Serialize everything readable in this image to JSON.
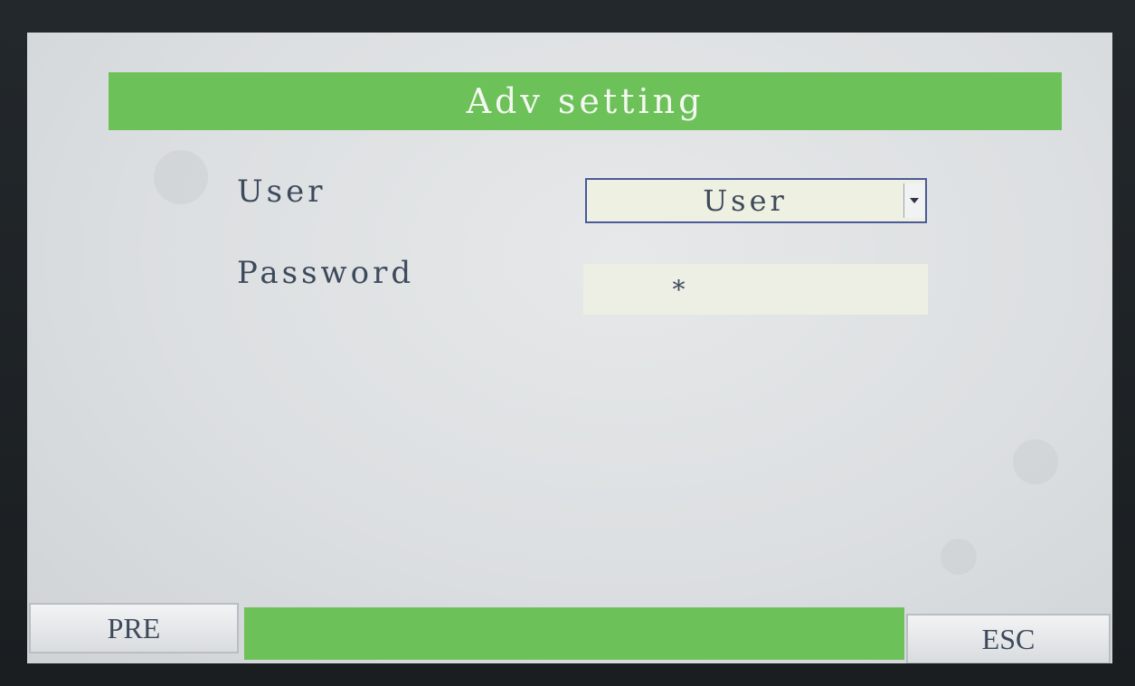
{
  "screen": {
    "title": "Adv setting",
    "accent_color": "#6cc259"
  },
  "form": {
    "user_label": "User",
    "user_value": "User",
    "password_label": "Password",
    "password_value": "*"
  },
  "footer": {
    "pre_label": "PRE",
    "esc_label": "ESC"
  },
  "icons": {
    "dropdown": "chevron-down-icon"
  }
}
